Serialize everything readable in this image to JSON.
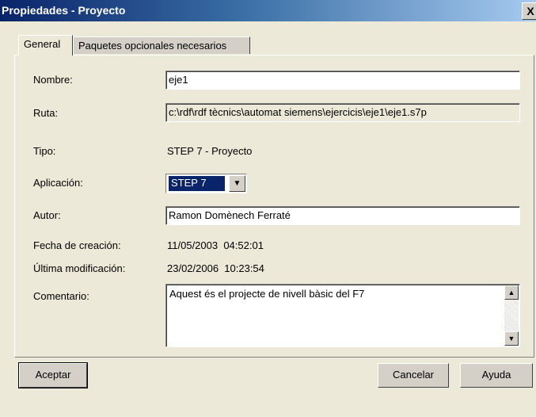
{
  "window": {
    "title": "Propiedades - Proyecto",
    "close_glyph": "X"
  },
  "tabs": [
    {
      "label": "General",
      "active": true
    },
    {
      "label": "Paquetes opcionales necesarios",
      "active": false
    }
  ],
  "form": {
    "nombre": {
      "label": "Nombre:",
      "value": "eje1"
    },
    "ruta": {
      "label": "Ruta:",
      "value": "c:\\rdf\\rdf tècnics\\automat siemens\\ejercicis\\eje1\\eje1.s7p"
    },
    "tipo": {
      "label": "Tipo:",
      "value": "STEP 7 - Proyecto"
    },
    "aplicacion": {
      "label": "Aplicación:",
      "value": "STEP 7"
    },
    "autor": {
      "label": "Autor:",
      "value": "Ramon Domènech Ferraté"
    },
    "fecha_creacion": {
      "label": "Fecha de creación:",
      "value": "11/05/2003  04:52:01"
    },
    "ultima_modificacion": {
      "label": "Última modificación:",
      "value": "23/02/2006  10:23:54"
    },
    "comentario": {
      "label": "Comentario:",
      "value": "Aquest és el projecte de nivell bàsic del F7"
    }
  },
  "buttons": {
    "accept": "Aceptar",
    "cancel": "Cancelar",
    "help": "Ayuda"
  },
  "icons": {
    "close": "close-icon",
    "dropdown": "chevron-down-icon",
    "scroll_up": "arrow-up-icon",
    "scroll_down": "arrow-down-icon"
  }
}
